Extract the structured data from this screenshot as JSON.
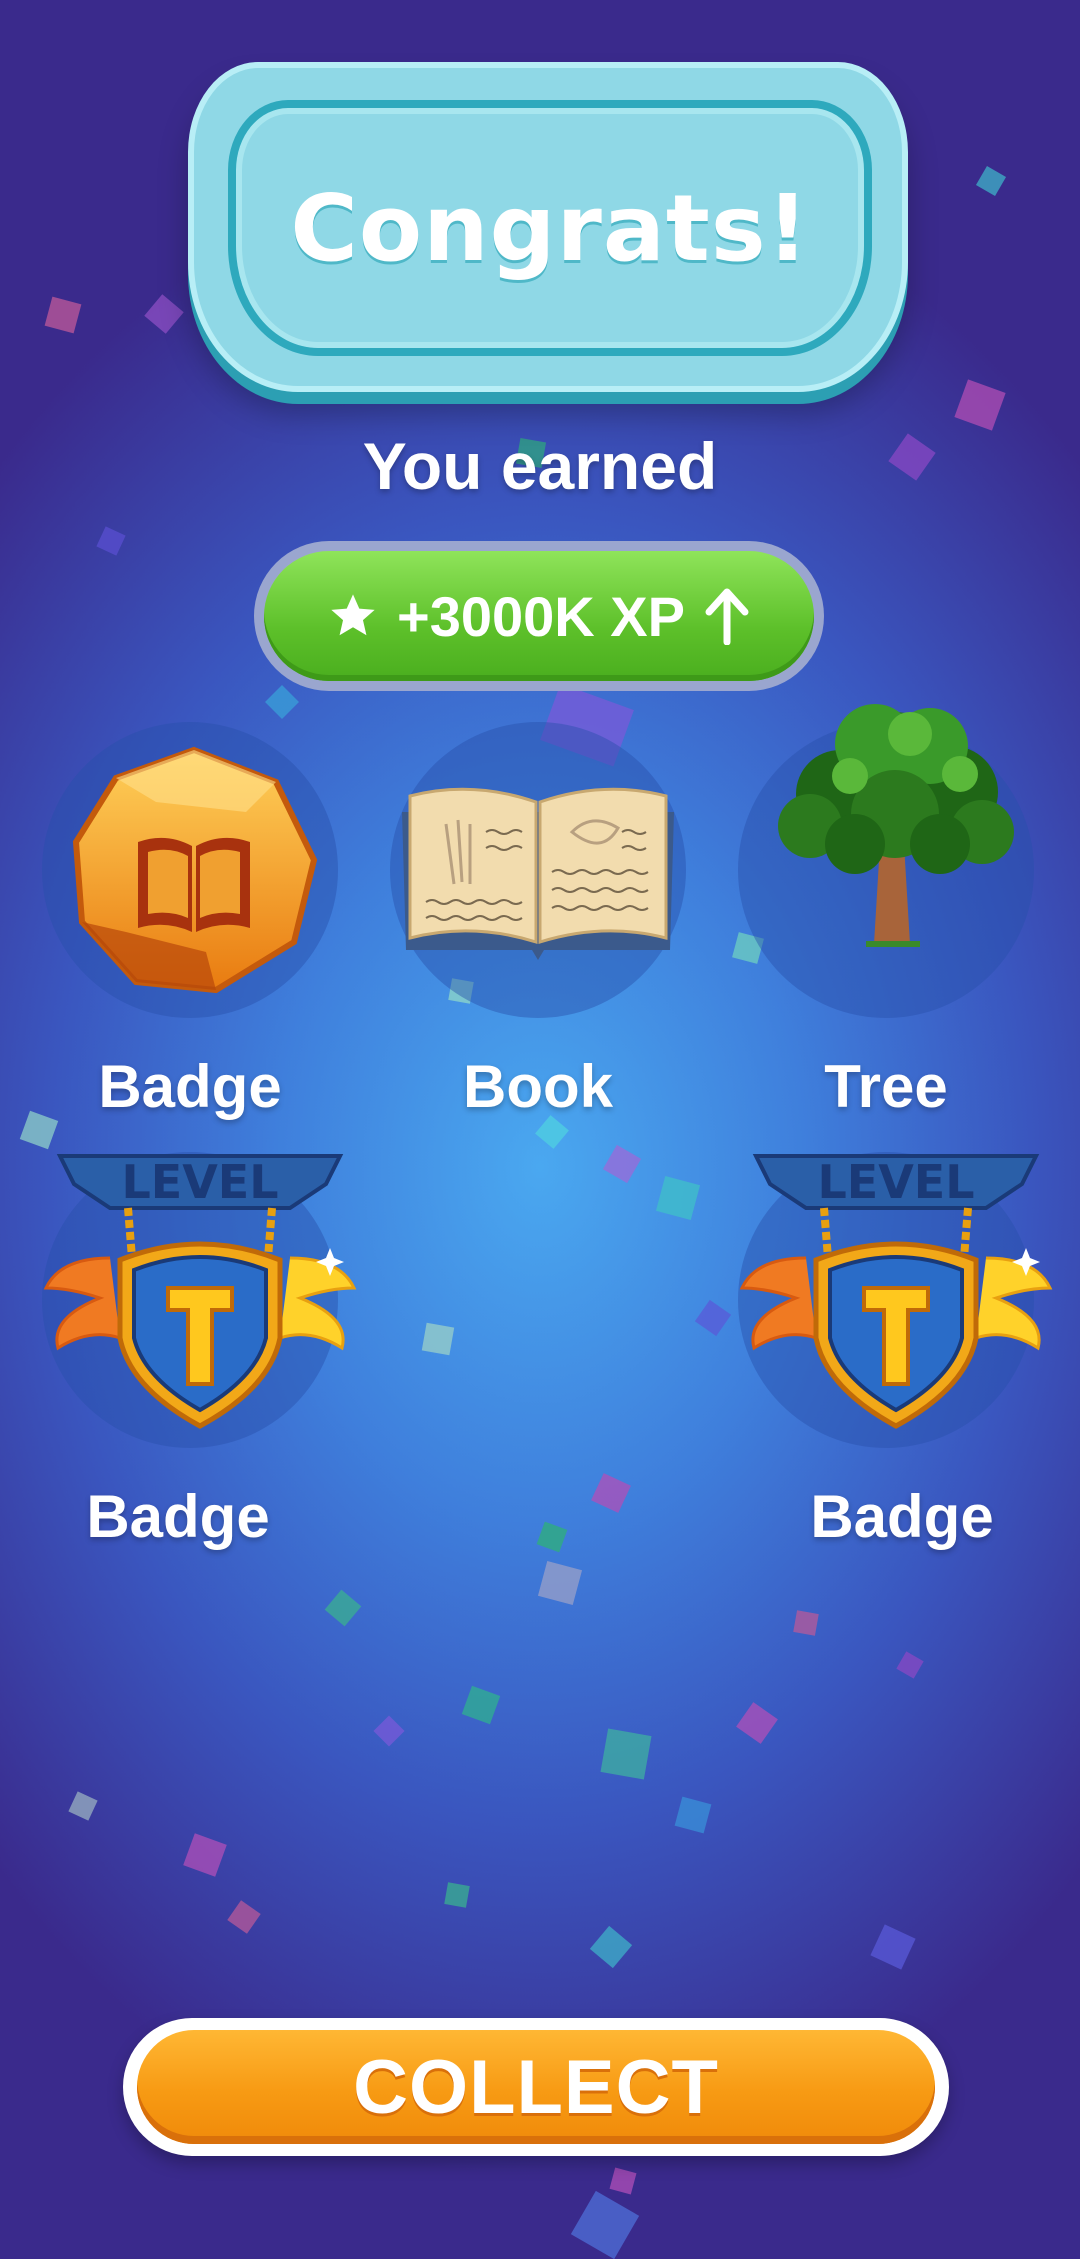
{
  "banner": {
    "title": "Congrats!"
  },
  "subtitle": "You earned",
  "xp": {
    "icon": "star-icon",
    "label": "+3000K XP",
    "trend_icon": "arrow-up-icon"
  },
  "rewards": [
    {
      "label": "Badge",
      "icon": "book-gem-badge-icon"
    },
    {
      "label": "Book",
      "icon": "open-book-icon"
    },
    {
      "label": "Tree",
      "icon": "tree-icon"
    },
    {
      "label": "Badge",
      "icon": "level-shield-badge-icon",
      "shield_text": "LEVEL"
    },
    {
      "label": "Badge",
      "icon": "level-shield-badge-icon",
      "shield_text": "LEVEL"
    }
  ],
  "collect_button": {
    "label": "COLLECT"
  },
  "colors": {
    "background": "#3f7fdc",
    "banner": "#8fd8e6",
    "xp_green": "#5dc02a",
    "collect_orange": "#f79a13"
  }
}
